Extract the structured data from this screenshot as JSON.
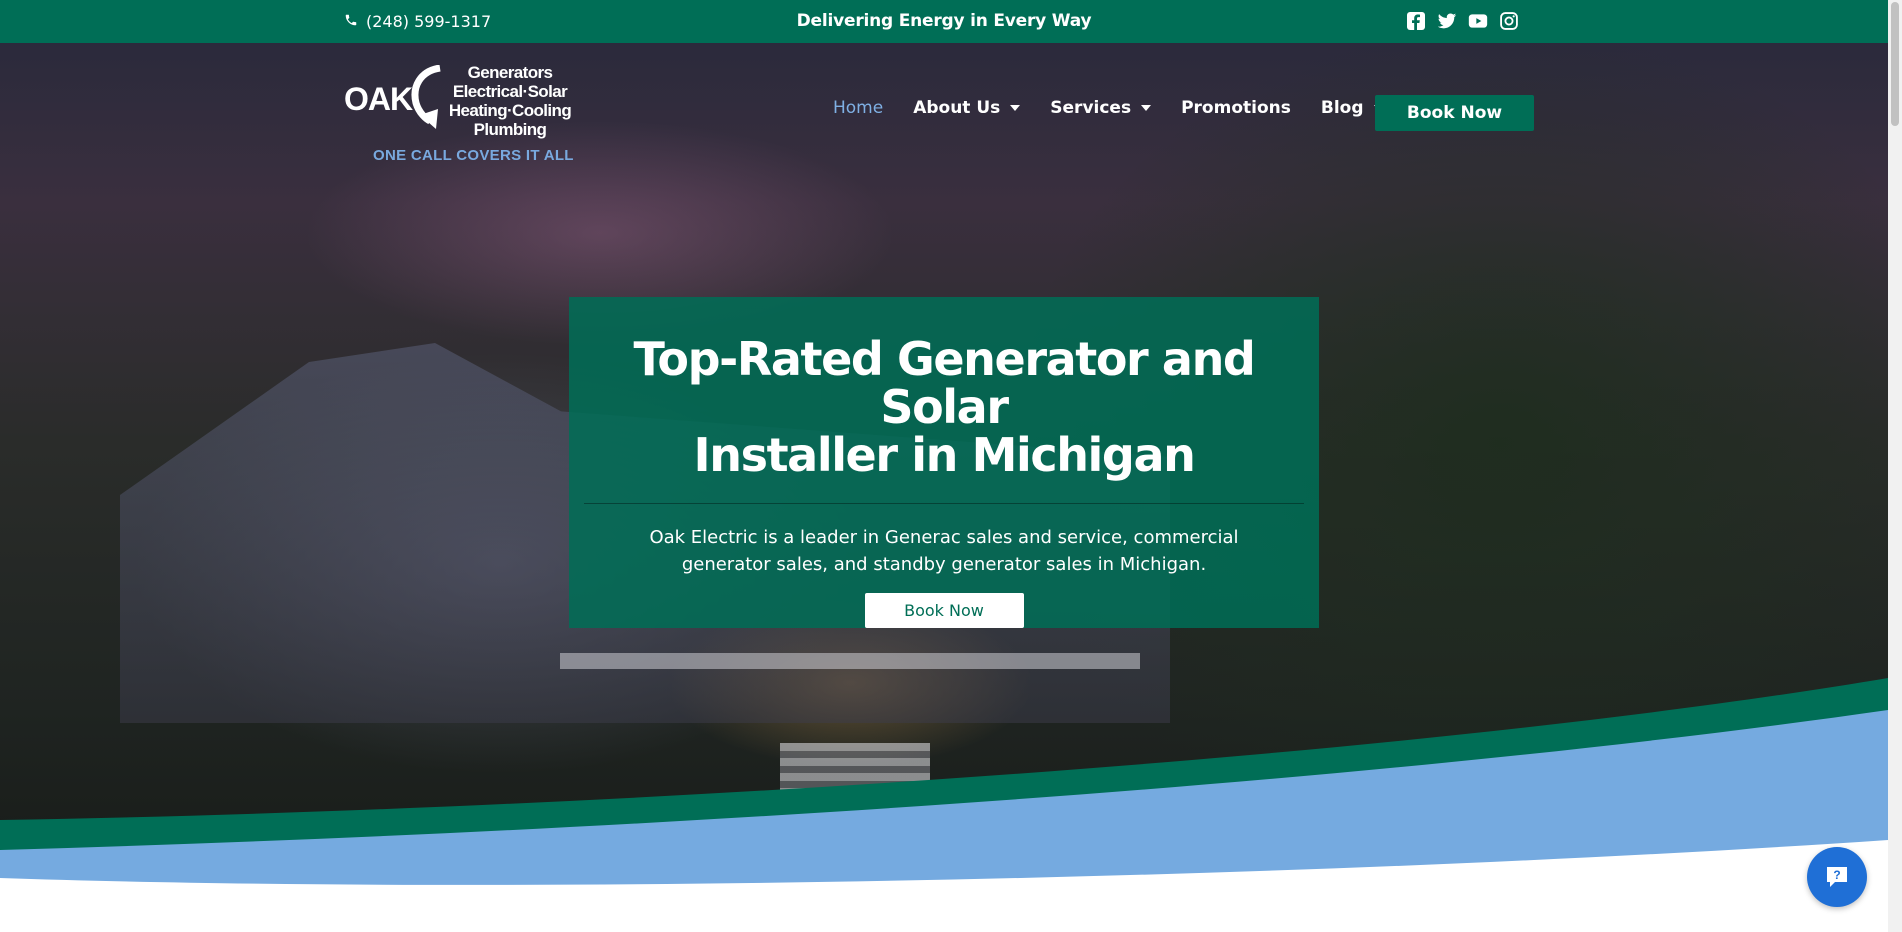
{
  "topbar": {
    "phone": "(248) 599-1317",
    "tagline": "Delivering Energy in Every Way",
    "social_icons": [
      "facebook-icon",
      "twitter-icon",
      "youtube-icon",
      "instagram-icon"
    ]
  },
  "logo": {
    "wordmark": "OAK",
    "lines": [
      "Generators",
      "Electrical·Solar",
      "Heating·Cooling",
      "Plumbing"
    ],
    "slogan": "ONE CALL COVERS IT ALL"
  },
  "nav": {
    "items": [
      {
        "label": "Home",
        "active": true,
        "dropdown": false
      },
      {
        "label": "About Us",
        "active": false,
        "dropdown": true
      },
      {
        "label": "Services",
        "active": false,
        "dropdown": true
      },
      {
        "label": "Promotions",
        "active": false,
        "dropdown": false
      },
      {
        "label": "Blog",
        "active": false,
        "dropdown": true
      }
    ],
    "cta": "Book Now"
  },
  "hero": {
    "title_line1": "Top-Rated Generator and Solar",
    "title_line2": "Installer in Michigan",
    "text": "Oak Electric is a leader in Generac sales and service, commercial generator sales, and standby generator sales in Michigan.",
    "cta": "Book Now"
  },
  "colors": {
    "brand_green": "#006e56",
    "nav_active": "#7fb0e4",
    "wave_blue": "#75aae0",
    "chat_blue": "#1f6fd6"
  }
}
